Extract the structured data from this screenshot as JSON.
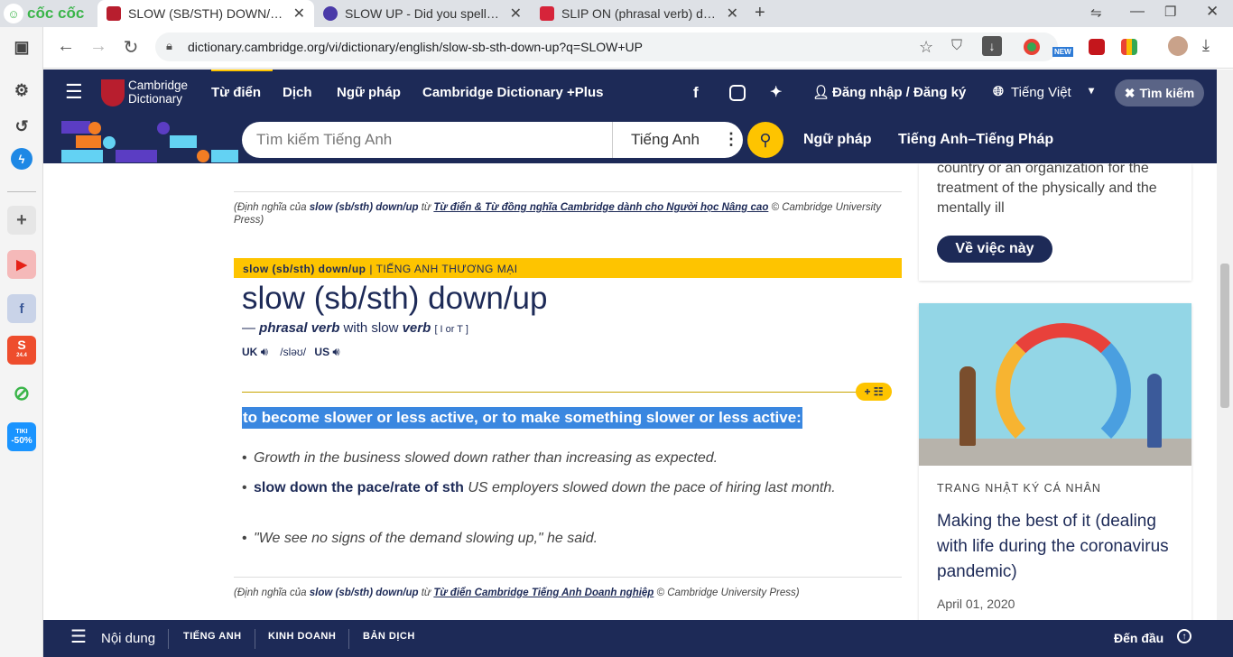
{
  "browser": {
    "brand": "cốc cốc",
    "tabs": [
      {
        "title": "SLOW (SB/STH) DOWN/UP | E",
        "active": true
      },
      {
        "title": "SLOW UP - Did you spell it co",
        "active": false
      },
      {
        "title": "SLIP ON (phrasal verb) definit",
        "active": false
      }
    ],
    "new_tab": "+",
    "url": "dictionary.cambridge.org/vi/dictionary/english/slow-sb-sth-down-up?q=SLOW+UP"
  },
  "sidebar": {
    "tiki_label": "TIKI",
    "tiki_badge": "-50%",
    "shopee_badge": "24.4"
  },
  "header": {
    "logo_line1": "Cambridge",
    "logo_line2": "Dictionary",
    "nav": [
      "Từ điển",
      "Dịch",
      "Ngữ pháp",
      "Cambridge Dictionary +Plus"
    ],
    "login": "Đăng nhập / Đăng ký",
    "language": "Tiếng Việt",
    "search_toggle": "Tìm kiếm",
    "search_placeholder": "Tìm kiếm Tiếng Anh",
    "search_lang": "Tiếng Anh",
    "links": [
      "Ngữ pháp",
      "Tiếng Anh–Tiếng Pháp"
    ]
  },
  "entry": {
    "cite1_prefix": "(Định nghĩa của ",
    "cite1_word": "slow (sb/sth) down/up",
    "cite1_mid": " từ ",
    "cite1_source": "Từ điển & Từ đồng nghĩa Cambridge dành cho Người học Nâng cao",
    "cite1_suffix": " © Cambridge University Press)",
    "section_word": "slow (sb/sth) down/up",
    "section_label": " | TIẾNG ANH THƯƠNG MẠI",
    "headword": "slow (sb/sth) down/up",
    "pos_dash": "— ",
    "pos": "phrasal verb",
    "pos_with": " with slow ",
    "pos_verb": "verb",
    "grammar": "[ I or T ]",
    "uk": "UK",
    "ipa": "/sləʊ/",
    "us": "US",
    "definition": "to become slower or less active, or to make something slower or less active:",
    "examples": [
      {
        "bold": "",
        "text": "Growth in the business slowed down rather than increasing as expected."
      },
      {
        "bold": "slow down the pace/rate of sth",
        "text": " US employers slowed down the pace of hiring last month."
      },
      {
        "bold": "",
        "text": "\"We see no signs of the demand slowing up,\" he said."
      }
    ],
    "cite2_prefix": "(Định nghĩa của ",
    "cite2_word": "slow (sb/sth) down/up",
    "cite2_mid": " từ ",
    "cite2_source": "Từ điển Cambridge Tiếng Anh Doanh nghiệp",
    "cite2_suffix": " © Cambridge University Press)"
  },
  "right": {
    "card1_text": "country or an organization for the treatment of the physically and the mentally ill",
    "card1_button": "Về việc này",
    "blog_category": "TRANG NHẬT KÝ CÁ NHÂN",
    "blog_title": "Making the best of it (dealing with life during the coronavirus pandemic)",
    "blog_date": "April 01, 2020"
  },
  "bottom": {
    "menu": "Nội dung",
    "tabs": [
      "TIẾNG ANH",
      "KINH DOANH",
      "BẢN DỊCH"
    ],
    "top": "Đến đầu"
  },
  "colors": {
    "navy": "#1d2a57",
    "yellow": "#fec400",
    "highlight": "#3a87e0"
  }
}
